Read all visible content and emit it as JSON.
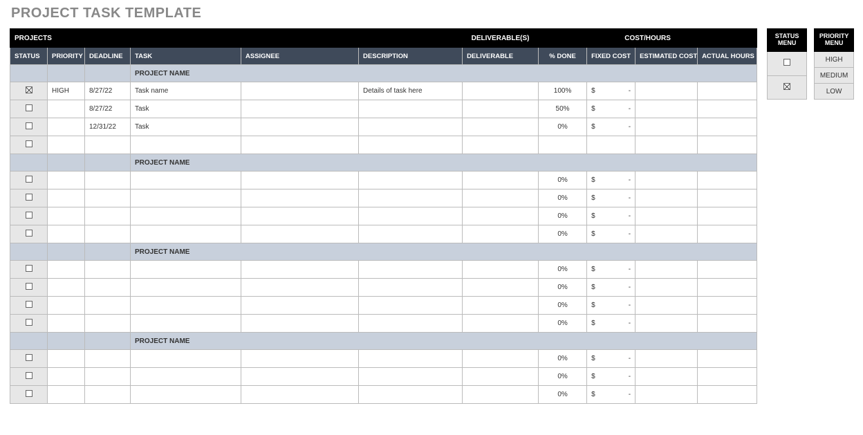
{
  "title": "PROJECT TASK TEMPLATE",
  "top_headers": {
    "projects": "PROJECTS",
    "deliverables": "DELIVERABLE(S)",
    "cost_hours": "COST/HOURS"
  },
  "columns": {
    "status": "STATUS",
    "priority": "PRIORITY",
    "deadline": "DEADLINE",
    "task": "TASK",
    "assignee": "ASSIGNEE",
    "description": "DESCRIPTION",
    "deliverable": "DELIVERABLE",
    "pct_done": "% DONE",
    "fixed_cost": "FIXED COST",
    "est_cost": "ESTIMATED COST",
    "actual_hours": "ACTUAL HOURS"
  },
  "section_label": "PROJECT NAME",
  "money_symbol": "$",
  "money_dash": "-",
  "groups": [
    {
      "rows": [
        {
          "status": "checked",
          "priority": "HIGH",
          "deadline": "8/27/22",
          "task": "Task name",
          "assignee": "",
          "description": "Details of task here",
          "deliverable": "",
          "pct_done": "100%",
          "fixed_cost": true,
          "est_cost": "",
          "hours": ""
        },
        {
          "status": "empty",
          "priority": "",
          "deadline": "8/27/22",
          "task": "Task",
          "assignee": "",
          "description": "",
          "deliverable": "",
          "pct_done": "50%",
          "fixed_cost": true,
          "est_cost": "",
          "hours": ""
        },
        {
          "status": "empty",
          "priority": "",
          "deadline": "12/31/22",
          "task": "Task",
          "assignee": "",
          "description": "",
          "deliverable": "",
          "pct_done": "0%",
          "fixed_cost": true,
          "est_cost": "",
          "hours": ""
        },
        {
          "status": "empty",
          "priority": "",
          "deadline": "",
          "task": "",
          "assignee": "",
          "description": "",
          "deliverable": "",
          "pct_done": "",
          "fixed_cost": false,
          "est_cost": "",
          "hours": ""
        }
      ]
    },
    {
      "rows": [
        {
          "status": "empty",
          "priority": "",
          "deadline": "",
          "task": "",
          "assignee": "",
          "description": "",
          "deliverable": "",
          "pct_done": "0%",
          "fixed_cost": true,
          "est_cost": "",
          "hours": ""
        },
        {
          "status": "empty",
          "priority": "",
          "deadline": "",
          "task": "",
          "assignee": "",
          "description": "",
          "deliverable": "",
          "pct_done": "0%",
          "fixed_cost": true,
          "est_cost": "",
          "hours": ""
        },
        {
          "status": "empty",
          "priority": "",
          "deadline": "",
          "task": "",
          "assignee": "",
          "description": "",
          "deliverable": "",
          "pct_done": "0%",
          "fixed_cost": true,
          "est_cost": "",
          "hours": ""
        },
        {
          "status": "empty",
          "priority": "",
          "deadline": "",
          "task": "",
          "assignee": "",
          "description": "",
          "deliverable": "",
          "pct_done": "0%",
          "fixed_cost": true,
          "est_cost": "",
          "hours": ""
        }
      ]
    },
    {
      "rows": [
        {
          "status": "empty",
          "priority": "",
          "deadline": "",
          "task": "",
          "assignee": "",
          "description": "",
          "deliverable": "",
          "pct_done": "0%",
          "fixed_cost": true,
          "est_cost": "",
          "hours": ""
        },
        {
          "status": "empty",
          "priority": "",
          "deadline": "",
          "task": "",
          "assignee": "",
          "description": "",
          "deliverable": "",
          "pct_done": "0%",
          "fixed_cost": true,
          "est_cost": "",
          "hours": ""
        },
        {
          "status": "empty",
          "priority": "",
          "deadline": "",
          "task": "",
          "assignee": "",
          "description": "",
          "deliverable": "",
          "pct_done": "0%",
          "fixed_cost": true,
          "est_cost": "",
          "hours": ""
        },
        {
          "status": "empty",
          "priority": "",
          "deadline": "",
          "task": "",
          "assignee": "",
          "description": "",
          "deliverable": "",
          "pct_done": "0%",
          "fixed_cost": true,
          "est_cost": "",
          "hours": ""
        }
      ]
    },
    {
      "rows": [
        {
          "status": "empty",
          "priority": "",
          "deadline": "",
          "task": "",
          "assignee": "",
          "description": "",
          "deliverable": "",
          "pct_done": "0%",
          "fixed_cost": true,
          "est_cost": "",
          "hours": ""
        },
        {
          "status": "empty",
          "priority": "",
          "deadline": "",
          "task": "",
          "assignee": "",
          "description": "",
          "deliverable": "",
          "pct_done": "0%",
          "fixed_cost": true,
          "est_cost": "",
          "hours": ""
        },
        {
          "status": "empty",
          "priority": "",
          "deadline": "",
          "task": "",
          "assignee": "",
          "description": "",
          "deliverable": "",
          "pct_done": "0%",
          "fixed_cost": true,
          "est_cost": "",
          "hours": ""
        }
      ]
    }
  ],
  "status_menu": {
    "title": "STATUS MENU",
    "items": [
      {
        "kind": "checkbox",
        "state": "empty"
      },
      {
        "kind": "checkbox",
        "state": "checked"
      }
    ]
  },
  "priority_menu": {
    "title": "PRIORITY MENU",
    "items": [
      {
        "kind": "text",
        "label": "HIGH"
      },
      {
        "kind": "text",
        "label": "MEDIUM"
      },
      {
        "kind": "text",
        "label": "LOW"
      }
    ]
  }
}
